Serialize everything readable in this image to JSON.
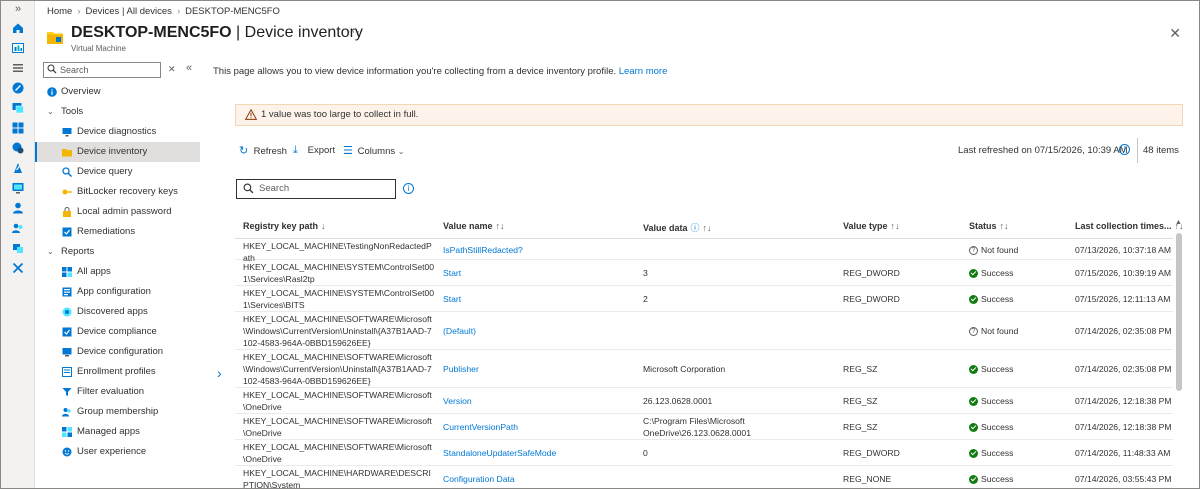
{
  "breadcrumb": [
    "Home",
    "Devices | All devices",
    "DESKTOP-MENC5FO"
  ],
  "header": {
    "device_name": "DESKTOP-MENC5FO",
    "separator": " | ",
    "page_name": "Device inventory",
    "subtitle": "Virtual Machine",
    "more": "···",
    "close": "✕"
  },
  "rail_icons": [
    "expand-icon",
    "home-icon",
    "dashboard-icon",
    "all-services-icon",
    "devices-icon",
    "apps-icon",
    "endpoint-security-icon",
    "reports-icon",
    "users-icon",
    "groups-icon",
    "tenant-admin-icon",
    "troubleshooting-icon"
  ],
  "nav": {
    "search_placeholder": "Search",
    "clear": "✕",
    "collapse": "«",
    "items": [
      {
        "type": "top",
        "label": "Overview",
        "icon": "info-icon"
      },
      {
        "type": "group",
        "label": "Tools"
      },
      {
        "type": "item",
        "label": "Device diagnostics",
        "icon": "monitor-icon"
      },
      {
        "type": "item",
        "label": "Device inventory",
        "icon": "folder-icon",
        "active": true
      },
      {
        "type": "item",
        "label": "Device query",
        "icon": "query-icon"
      },
      {
        "type": "item",
        "label": "BitLocker recovery keys",
        "icon": "key-icon"
      },
      {
        "type": "item",
        "label": "Local admin password",
        "icon": "password-icon"
      },
      {
        "type": "item",
        "label": "Remediations",
        "icon": "remediation-icon"
      },
      {
        "type": "group",
        "label": "Reports"
      },
      {
        "type": "item",
        "label": "All apps",
        "icon": "apps-icon"
      },
      {
        "type": "item",
        "label": "App configuration",
        "icon": "app-config-icon"
      },
      {
        "type": "item",
        "label": "Discovered apps",
        "icon": "discovered-apps-icon"
      },
      {
        "type": "item",
        "label": "Device compliance",
        "icon": "compliance-icon"
      },
      {
        "type": "item",
        "label": "Device configuration",
        "icon": "configuration-icon"
      },
      {
        "type": "item",
        "label": "Enrollment profiles",
        "icon": "enrollment-icon"
      },
      {
        "type": "item",
        "label": "Filter evaluation",
        "icon": "filter-icon"
      },
      {
        "type": "item",
        "label": "Group membership",
        "icon": "group-icon"
      },
      {
        "type": "item",
        "label": "Managed apps",
        "icon": "managed-apps-icon"
      },
      {
        "type": "item",
        "label": "User experience",
        "icon": "user-experience-icon"
      }
    ]
  },
  "main": {
    "description": "This page allows you to view device information you're collecting from a device inventory profile.",
    "learn_more": "Learn more",
    "warning": "1 value was too large to collect in full.",
    "toolbar": {
      "refresh": "Refresh",
      "export": "Export",
      "columns": "Columns"
    },
    "last_refreshed": "Last refreshed on 07/15/2026, 10:39 AM",
    "item_count": "48 items",
    "search_placeholder": "Search"
  },
  "table": {
    "columns": [
      {
        "label": "Registry key path",
        "sort": "↓"
      },
      {
        "label": "Value name",
        "sort": "↑↓"
      },
      {
        "label": "Value data",
        "sort": "↑↓",
        "info": true
      },
      {
        "label": "Value type",
        "sort": "↑↓"
      },
      {
        "label": "Status",
        "sort": "↑↓"
      },
      {
        "label": "Last collection times...",
        "sort": "↑↓"
      }
    ],
    "rows": [
      {
        "path": "HKEY_LOCAL_MACHINE\\TestingNonRedactedPath",
        "name": "IsPathStillRedacted?",
        "data": "",
        "type": "",
        "status": "Not found",
        "time": "07/13/2026, 10:37:18 AM"
      },
      {
        "path": "HKEY_LOCAL_MACHINE\\SYSTEM\\ControlSet001\\Services\\Rasl2tp",
        "name": "Start",
        "data": "3",
        "type": "REG_DWORD",
        "status": "Success",
        "time": "07/15/2026, 10:39:19 AM"
      },
      {
        "path": "HKEY_LOCAL_MACHINE\\SYSTEM\\ControlSet001\\Services\\BITS",
        "name": "Start",
        "data": "2",
        "type": "REG_DWORD",
        "status": "Success",
        "time": "07/15/2026, 12:11:13 AM"
      },
      {
        "path": "HKEY_LOCAL_MACHINE\\SOFTWARE\\Microsoft\\Windows\\CurrentVersion\\Uninstall\\{A37B1AAD-7102-4583-964A-0BBD159626EE}",
        "name": "(Default)",
        "data": "",
        "type": "",
        "status": "Not found",
        "time": "07/14/2026, 02:35:08 PM"
      },
      {
        "path": "HKEY_LOCAL_MACHINE\\SOFTWARE\\Microsoft\\Windows\\CurrentVersion\\Uninstall\\{A37B1AAD-7102-4583-964A-0BBD159626EE}",
        "name": "Publisher",
        "data": "Microsoft Corporation",
        "type": "REG_SZ",
        "status": "Success",
        "time": "07/14/2026, 02:35:08 PM"
      },
      {
        "path": "HKEY_LOCAL_MACHINE\\SOFTWARE\\Microsoft\\OneDrive",
        "name": "Version",
        "data": "26.123.0628.0001",
        "type": "REG_SZ",
        "status": "Success",
        "time": "07/14/2026, 12:18:38 PM"
      },
      {
        "path": "HKEY_LOCAL_MACHINE\\SOFTWARE\\Microsoft\\OneDrive",
        "name": "CurrentVersionPath",
        "data": "C:\\Program Files\\Microsoft OneDrive\\26.123.0628.0001",
        "type": "REG_SZ",
        "status": "Success",
        "time": "07/14/2026, 12:18:38 PM"
      },
      {
        "path": "HKEY_LOCAL_MACHINE\\SOFTWARE\\Microsoft\\OneDrive",
        "name": "StandaloneUpdaterSafeMode",
        "data": "0",
        "type": "REG_DWORD",
        "status": "Success",
        "time": "07/14/2026, 11:48:33 AM"
      },
      {
        "path": "HKEY_LOCAL_MACHINE\\HARDWARE\\DESCRIPTION\\System",
        "name": "Configuration Data",
        "data": "",
        "type": "REG_NONE",
        "status": "Success",
        "time": "07/14/2026, 03:55:43 PM"
      }
    ]
  },
  "colors": {
    "accent": "#0078d4",
    "success": "#107c10",
    "warning_bg": "#fdf3ea"
  }
}
